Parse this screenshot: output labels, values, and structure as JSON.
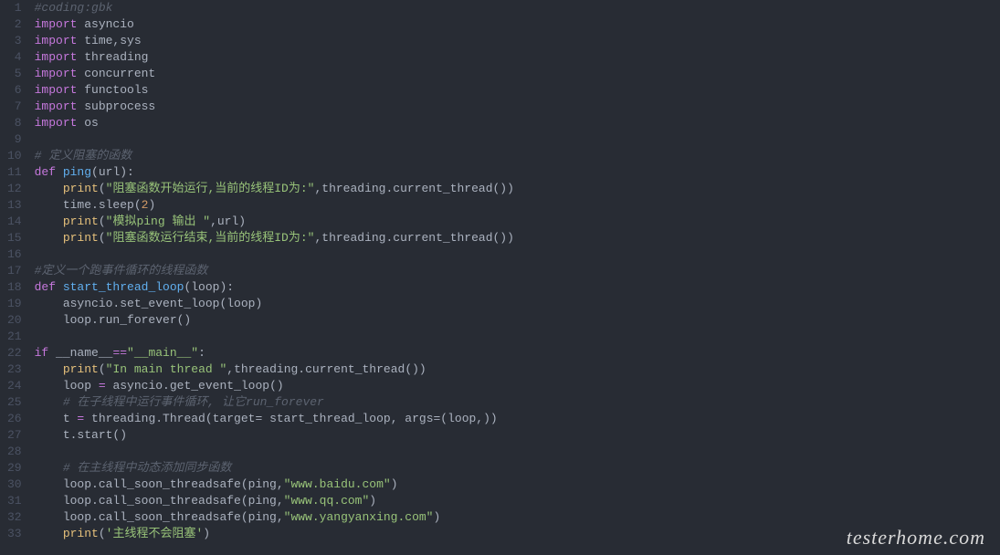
{
  "watermark": "testerhome.com",
  "code": {
    "lines": [
      {
        "n": 1,
        "tokens": [
          [
            "c-comment",
            "#coding:gbk"
          ]
        ]
      },
      {
        "n": 2,
        "tokens": [
          [
            "c-keyword",
            "import"
          ],
          [
            "c-plain",
            " asyncio"
          ]
        ]
      },
      {
        "n": 3,
        "tokens": [
          [
            "c-keyword",
            "import"
          ],
          [
            "c-plain",
            " time,sys"
          ]
        ]
      },
      {
        "n": 4,
        "tokens": [
          [
            "c-keyword",
            "import"
          ],
          [
            "c-plain",
            " threading"
          ]
        ]
      },
      {
        "n": 5,
        "tokens": [
          [
            "c-keyword",
            "import"
          ],
          [
            "c-plain",
            " concurrent"
          ]
        ]
      },
      {
        "n": 6,
        "tokens": [
          [
            "c-keyword",
            "import"
          ],
          [
            "c-plain",
            " functools"
          ]
        ]
      },
      {
        "n": 7,
        "tokens": [
          [
            "c-keyword",
            "import"
          ],
          [
            "c-plain",
            " subprocess"
          ]
        ]
      },
      {
        "n": 8,
        "tokens": [
          [
            "c-keyword",
            "import"
          ],
          [
            "c-plain",
            " os"
          ]
        ]
      },
      {
        "n": 9,
        "tokens": []
      },
      {
        "n": 10,
        "tokens": [
          [
            "c-comment",
            "# 定义阻塞的函数"
          ]
        ]
      },
      {
        "n": 11,
        "tokens": [
          [
            "c-keyword",
            "def "
          ],
          [
            "c-func",
            "ping"
          ],
          [
            "c-plain",
            "(url):"
          ]
        ]
      },
      {
        "n": 12,
        "tokens": [
          [
            "c-plain",
            "    "
          ],
          [
            "c-builtin",
            "print"
          ],
          [
            "c-plain",
            "("
          ],
          [
            "c-string",
            "\"阻塞函数开始运行,当前的线程ID为:\""
          ],
          [
            "c-plain",
            ",threading.current_thread())"
          ]
        ]
      },
      {
        "n": 13,
        "tokens": [
          [
            "c-plain",
            "    time.sleep("
          ],
          [
            "c-number",
            "2"
          ],
          [
            "c-plain",
            ")"
          ]
        ]
      },
      {
        "n": 14,
        "tokens": [
          [
            "c-plain",
            "    "
          ],
          [
            "c-builtin",
            "print"
          ],
          [
            "c-plain",
            "("
          ],
          [
            "c-string",
            "\"模拟ping 输出 \""
          ],
          [
            "c-plain",
            ",url)"
          ]
        ]
      },
      {
        "n": 15,
        "tokens": [
          [
            "c-plain",
            "    "
          ],
          [
            "c-builtin",
            "print"
          ],
          [
            "c-plain",
            "("
          ],
          [
            "c-string",
            "\"阻塞函数运行结束,当前的线程ID为:\""
          ],
          [
            "c-plain",
            ",threading.current_thread())"
          ]
        ]
      },
      {
        "n": 16,
        "tokens": []
      },
      {
        "n": 17,
        "tokens": [
          [
            "c-comment",
            "#定义一个跑事件循环的线程函数"
          ]
        ]
      },
      {
        "n": 18,
        "tokens": [
          [
            "c-keyword",
            "def "
          ],
          [
            "c-func",
            "start_thread_loop"
          ],
          [
            "c-plain",
            "(loop):"
          ]
        ]
      },
      {
        "n": 19,
        "tokens": [
          [
            "c-plain",
            "    asyncio.set_event_loop(loop)"
          ]
        ]
      },
      {
        "n": 20,
        "tokens": [
          [
            "c-plain",
            "    loop.run_forever()"
          ]
        ]
      },
      {
        "n": 21,
        "tokens": []
      },
      {
        "n": 22,
        "tokens": [
          [
            "c-keyword",
            "if"
          ],
          [
            "c-plain",
            " __name__"
          ],
          [
            "c-op",
            "=="
          ],
          [
            "c-string",
            "\"__main__\""
          ],
          [
            "c-plain",
            ":"
          ]
        ]
      },
      {
        "n": 23,
        "tokens": [
          [
            "c-plain",
            "    "
          ],
          [
            "c-builtin",
            "print"
          ],
          [
            "c-plain",
            "("
          ],
          [
            "c-string",
            "\"In main thread \""
          ],
          [
            "c-plain",
            ",threading.current_thread())"
          ]
        ]
      },
      {
        "n": 24,
        "tokens": [
          [
            "c-plain",
            "    loop "
          ],
          [
            "c-op",
            "="
          ],
          [
            "c-plain",
            " asyncio.get_event_loop()"
          ]
        ]
      },
      {
        "n": 25,
        "tokens": [
          [
            "c-plain",
            "    "
          ],
          [
            "c-comment",
            "# 在子线程中运行事件循环, 让它run_forever"
          ]
        ]
      },
      {
        "n": 26,
        "tokens": [
          [
            "c-plain",
            "    t "
          ],
          [
            "c-op",
            "="
          ],
          [
            "c-plain",
            " threading.Thread(target= start_thread_loop, args=(loop,))"
          ]
        ]
      },
      {
        "n": 27,
        "tokens": [
          [
            "c-plain",
            "    t.start()"
          ]
        ]
      },
      {
        "n": 28,
        "tokens": []
      },
      {
        "n": 29,
        "tokens": [
          [
            "c-plain",
            "    "
          ],
          [
            "c-comment",
            "# 在主线程中动态添加同步函数"
          ]
        ]
      },
      {
        "n": 30,
        "tokens": [
          [
            "c-plain",
            "    loop.call_soon_threadsafe(ping,"
          ],
          [
            "c-string",
            "\"www.baidu.com\""
          ],
          [
            "c-plain",
            ")"
          ]
        ]
      },
      {
        "n": 31,
        "tokens": [
          [
            "c-plain",
            "    loop.call_soon_threadsafe(ping,"
          ],
          [
            "c-string",
            "\"www.qq.com\""
          ],
          [
            "c-plain",
            ")"
          ]
        ]
      },
      {
        "n": 32,
        "tokens": [
          [
            "c-plain",
            "    loop.call_soon_threadsafe(ping,"
          ],
          [
            "c-string",
            "\"www.yangyanxing.com\""
          ],
          [
            "c-plain",
            ")"
          ]
        ]
      },
      {
        "n": 33,
        "tokens": [
          [
            "c-plain",
            "    "
          ],
          [
            "c-builtin",
            "print"
          ],
          [
            "c-plain",
            "("
          ],
          [
            "c-string",
            "'主线程不会阻塞'"
          ],
          [
            "c-plain",
            ")"
          ]
        ]
      }
    ]
  }
}
